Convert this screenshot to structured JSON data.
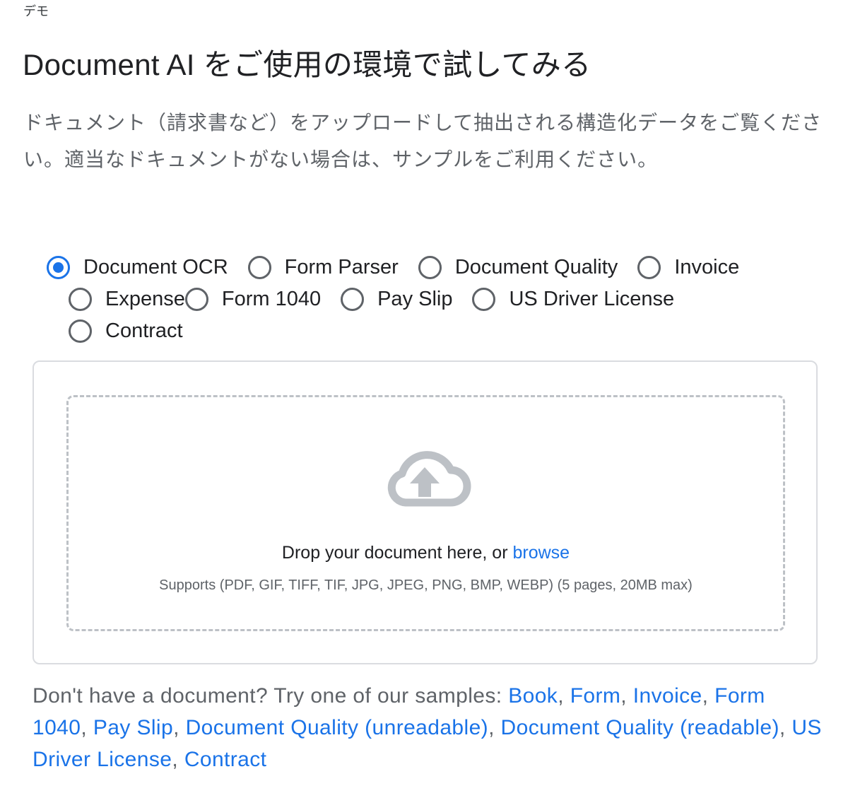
{
  "eyebrow": "デモ",
  "title": "Document AI をご使用の環境で試してみる",
  "description": "ドキュメント（請求書など）をアップロードして抽出される構造化データをご覧ください。適当なドキュメントがない場合は、サンプルをご利用ください。",
  "processors": {
    "selected": "Document OCR",
    "options": [
      {
        "label": "Document OCR",
        "checked": true
      },
      {
        "label": "Form Parser",
        "checked": false
      },
      {
        "label": "Document Quality",
        "checked": false
      },
      {
        "label": "Invoice",
        "checked": false
      },
      {
        "label": "Expense",
        "checked": false
      },
      {
        "label": "Form 1040",
        "checked": false
      },
      {
        "label": "Pay Slip",
        "checked": false
      },
      {
        "label": "US Driver License",
        "checked": false
      },
      {
        "label": "Contract",
        "checked": false
      }
    ]
  },
  "upload": {
    "icon": "cloud-upload-icon",
    "prompt": "Drop your document here, or ",
    "browse_label": "browse",
    "supports": "Supports (PDF, GIF, TIFF, TIF, JPG, JPEG, PNG, BMP, WEBP) (5 pages, 20MB max)"
  },
  "samples": {
    "intro": "Don't have a document? Try one of our samples: ",
    "links": [
      "Book",
      "Form",
      "Invoice",
      "Form 1040",
      "Pay Slip",
      "Document Quality (unreadable)",
      "Document Quality (readable)",
      "US Driver License",
      "Contract"
    ]
  },
  "colors": {
    "accent": "#1a73e8",
    "text": "#202124",
    "muted": "#5f6368",
    "border": "#dadce0",
    "dashed": "#bdc1c6",
    "icon": "#bdc1c6"
  }
}
